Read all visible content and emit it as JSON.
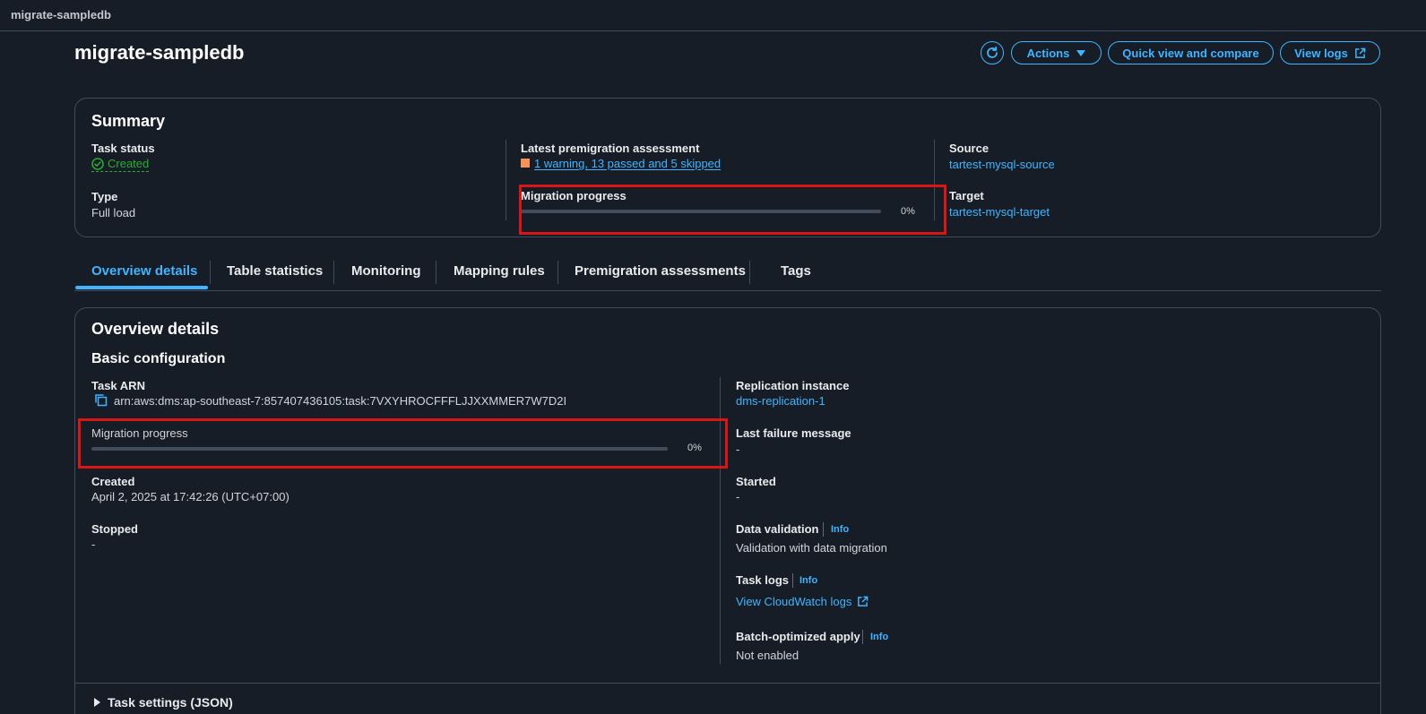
{
  "breadcrumb": "migrate-sampledb",
  "page_title": "migrate-sampledb",
  "header_buttons": {
    "actions": "Actions",
    "quick_view": "Quick view and compare",
    "view_logs": "View logs"
  },
  "summary": {
    "title": "Summary",
    "task_status_label": "Task status",
    "task_status_value": "Created",
    "type_label": "Type",
    "type_value": "Full load",
    "assessment_label": "Latest premigration assessment",
    "assessment_value": "1 warning, 13 passed and 5 skipped",
    "progress_label": "Migration progress",
    "progress_text": "0%",
    "progress_value": 0,
    "source_label": "Source",
    "source_value": "tartest-mysql-source",
    "target_label": "Target",
    "target_value": "tartest-mysql-target"
  },
  "tabs": [
    {
      "label": "Overview details",
      "active": true
    },
    {
      "label": "Table statistics"
    },
    {
      "label": "Monitoring"
    },
    {
      "label": "Mapping rules"
    },
    {
      "label": "Premigration assessments"
    },
    {
      "label": "Tags"
    }
  ],
  "overview": {
    "title": "Overview details",
    "section": "Basic configuration",
    "task_arn_label": "Task ARN",
    "task_arn_value": "arn:aws:dms:ap-southeast-7:857407436105:task:7VXYHROCFFFLJJXXMMER7W7D2I",
    "progress_label": "Migration progress",
    "progress_text": "0%",
    "progress_value": 0,
    "created_label": "Created",
    "created_value": "April 2, 2025 at 17:42:26 (UTC+07:00)",
    "stopped_label": "Stopped",
    "stopped_value": "-",
    "replication_label": "Replication instance",
    "replication_value": "dms-replication-1",
    "last_failure_label": "Last failure message",
    "last_failure_value": "-",
    "started_label": "Started",
    "started_value": "-",
    "data_validation_label": "Data validation",
    "data_validation_value": "Validation with data migration",
    "task_logs_label": "Task logs",
    "task_logs_value": "View CloudWatch logs",
    "batch_label": "Batch-optimized apply",
    "batch_value": "Not enabled",
    "info": "Info",
    "task_settings": "Task settings (JSON)"
  },
  "colors": {
    "background": "#161d26",
    "accent": "#42b4ff",
    "success": "#29ad32",
    "warning": "#f89256",
    "highlight": "#d91515"
  }
}
